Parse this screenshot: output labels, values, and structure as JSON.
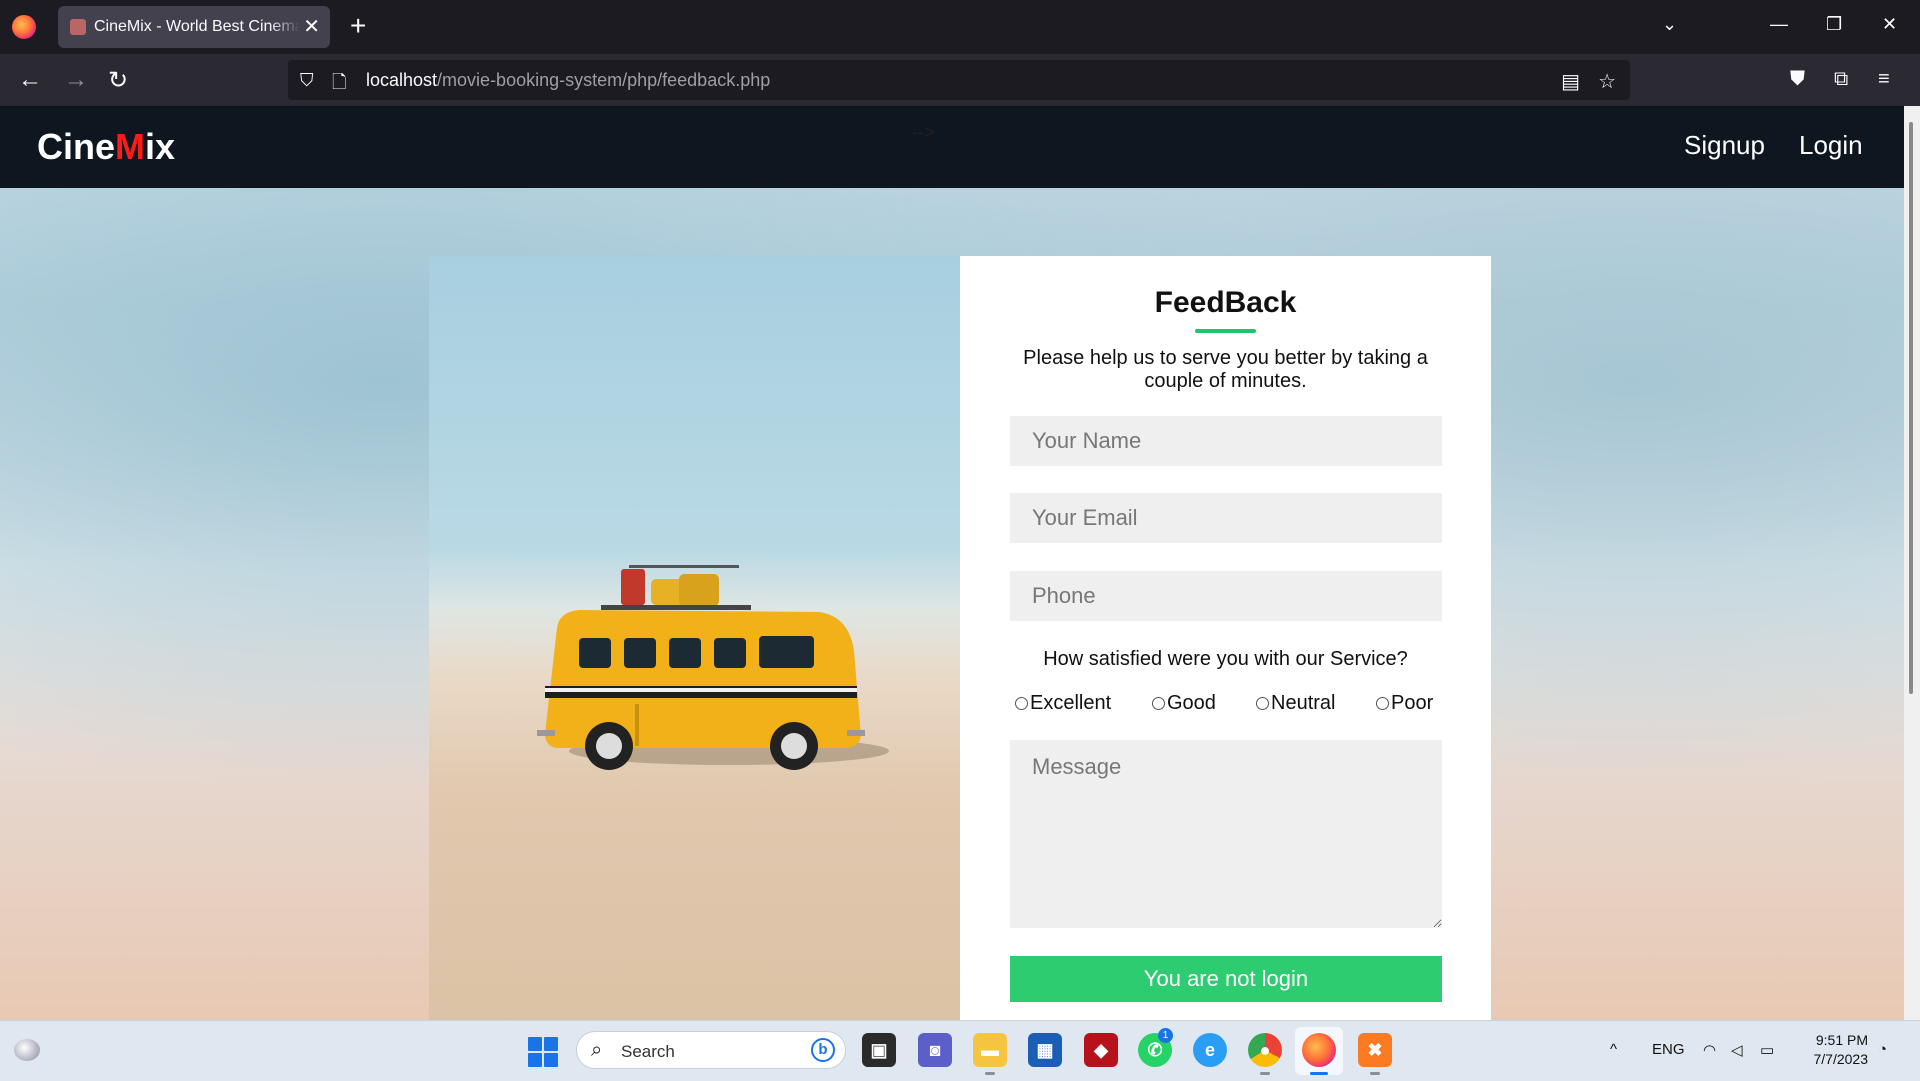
{
  "browser": {
    "tab_title": "CineMix - World Best Cinema Experience",
    "tab_close": "✕",
    "new_tab": "+",
    "tabs_list": "⌄",
    "url_host": "localhost",
    "url_path": "/movie-booking-system/php/feedback.php",
    "win_min": "—",
    "win_restore": "❐",
    "win_close": "✕",
    "back": "←",
    "forward": "→",
    "reload": "↻",
    "shield": "⛉",
    "page_icon": "🗋",
    "reader": "▤",
    "bookmark": "☆",
    "pocket": "⛊",
    "extensions": "⧉",
    "menu": "≡"
  },
  "site": {
    "brand_left": "Cine",
    "brand_accent": "M",
    "brand_right": "ix",
    "stray_text": "-->",
    "nav": {
      "signup": "Signup",
      "login": "Login"
    },
    "colors": {
      "header_bg": "#0e1620",
      "accent_red": "#ff1a1a",
      "accent_green": "#2ecc71"
    }
  },
  "form": {
    "title": "FeedBack",
    "subtitle": "Please help us to serve you better by taking a couple of minutes.",
    "name_placeholder": "Your Name",
    "email_placeholder": "Your Email",
    "phone_placeholder": "Phone",
    "question": "How satisfied were you with our Service?",
    "options": [
      "Excellent",
      "Good",
      "Neutral",
      "Poor"
    ],
    "message_placeholder": "Message",
    "submit_label": "You are not login"
  },
  "taskbar": {
    "search_label": "Search",
    "bing_label": "b",
    "whatsapp_badge": "1",
    "tray_language": "ENG",
    "tray_chevron": "^",
    "time": "9:51 PM",
    "date": "7/7/2023"
  }
}
